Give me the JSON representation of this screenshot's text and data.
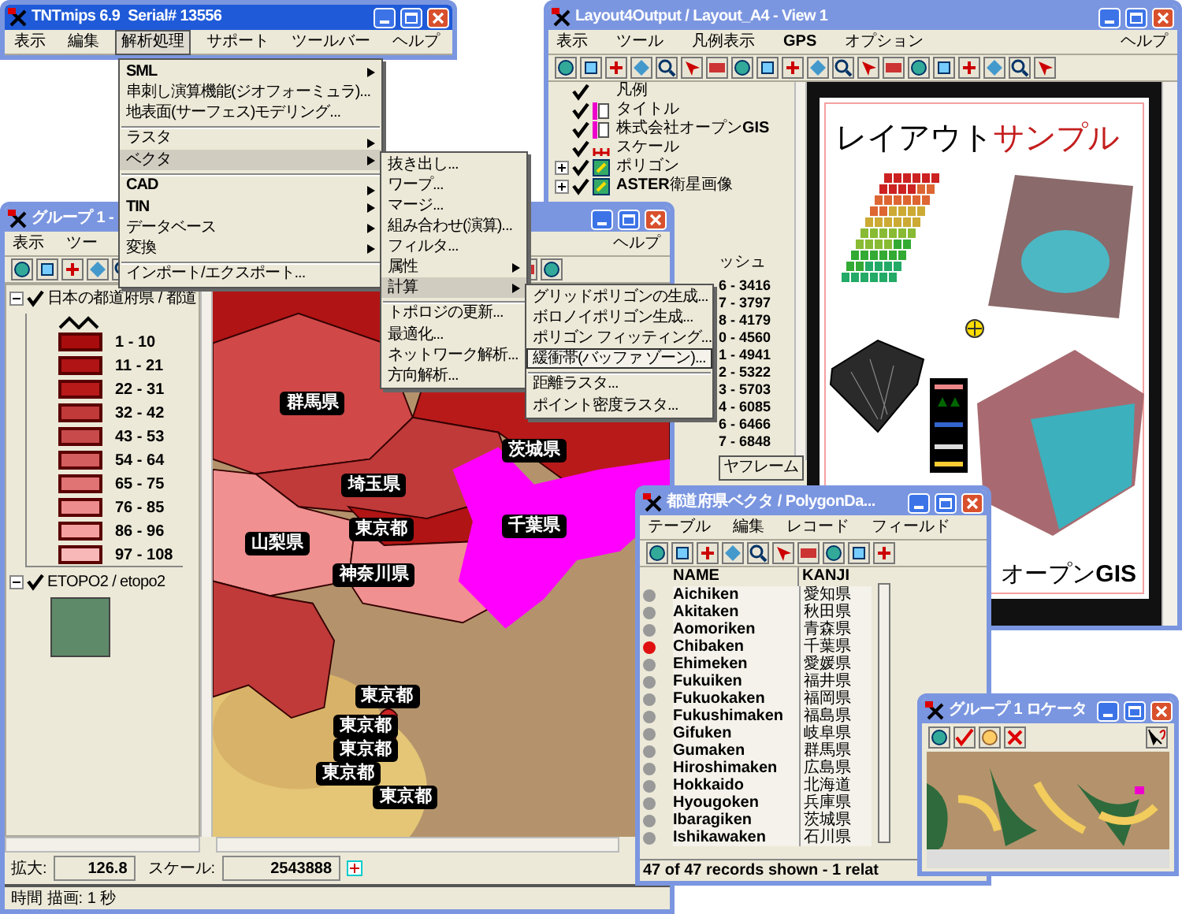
{
  "layout_window": {
    "title": "Layout4Output / Layout_A4 - View 1",
    "active": false,
    "menu": [
      {
        "label": "表示",
        "bold": false
      },
      {
        "label": "ツール",
        "bold": false
      },
      {
        "label": "凡例表示",
        "bold": false
      },
      {
        "label": "GPS",
        "bold": true
      },
      {
        "label": "オプション",
        "bold": false
      }
    ],
    "menu_right": "ヘルプ",
    "legend": [
      {
        "label": "凡例",
        "checked": true,
        "expandable": false,
        "kind": "plain"
      },
      {
        "label": "タイトル",
        "checked": true,
        "expandable": false,
        "kind": "text"
      },
      {
        "label": "株式会社オープン**GIS**",
        "checked": true,
        "expandable": false,
        "kind": "text"
      },
      {
        "label": "スケール",
        "checked": true,
        "expandable": false,
        "kind": "scale"
      },
      {
        "label": "ポリゴン",
        "checked": true,
        "expandable": true,
        "kind": "layer"
      },
      {
        "label": "**ASTER**衛星画像",
        "checked": true,
        "expandable": true,
        "kind": "layer"
      }
    ],
    "partial_legend": {
      "heading": "ッシュ",
      "ranges": [
        "6 - 3416",
        "7 - 3797",
        "8 - 4179",
        "0 - 4560",
        "1 - 4941",
        "2 - 5322",
        "3 - 5703",
        "4 - 6085",
        "6 - 6466",
        "7 - 6848"
      ]
    },
    "frame_button": "ヤフレーム",
    "page": {
      "title_main": "レイアウト",
      "title_accent": "サンプル",
      "footer": "オープン**GIS**"
    }
  },
  "group_window": {
    "title": "グループ 1 -",
    "active": false,
    "menu": [
      "表示",
      "ツー"
    ],
    "menu_right": "ヘルプ",
    "layers": [
      {
        "label": "日本の都道府県 / 都道",
        "checked": true,
        "expanded": true,
        "classes": [
          {
            "label": "1 - 10",
            "color": "#a80c0c"
          },
          {
            "label": "11 - 21",
            "color": "#b01414"
          },
          {
            "label": "22 - 31",
            "color": "#b81a1a"
          },
          {
            "label": "32 - 42",
            "color": "#c03a3a"
          },
          {
            "label": "43 - 53",
            "color": "#c84a4a"
          },
          {
            "label": "54 - 64",
            "color": "#d45e5e"
          },
          {
            "label": "65 - 75",
            "color": "#e07474"
          },
          {
            "label": "76 - 85",
            "color": "#ec8c8c"
          },
          {
            "label": "86 - 96",
            "color": "#f4a0a0"
          },
          {
            "label": "97 - 108",
            "color": "#f8b8b8"
          }
        ]
      },
      {
        "label": "ETOPO2 / etopo2",
        "checked": true,
        "expanded": true
      }
    ],
    "map_labels": [
      "群馬県",
      "茨城県",
      "埼玉県",
      "東京都",
      "千葉県",
      "山梨県",
      "神奈川県",
      "東京都",
      "東京都",
      "東京都",
      "東京都",
      "東京都"
    ],
    "zoom_label": "拡大:",
    "zoom_value": "126.8",
    "scale_label": "スケール:",
    "scale_value": "2543888",
    "status": "時間 描画: 1 秒"
  },
  "table_window": {
    "title": "都道府県ベクタ / PolygonDa...",
    "active": false,
    "menu": [
      "テーブル",
      "編集",
      "レコード",
      "フィールド"
    ],
    "columns": [
      "NAME",
      "KANJI"
    ],
    "rows": [
      {
        "name": "Aichiken",
        "kanji": "愛知県",
        "selected": false
      },
      {
        "name": "Akitaken",
        "kanji": "秋田県",
        "selected": false
      },
      {
        "name": "Aomoriken",
        "kanji": "青森県",
        "selected": false
      },
      {
        "name": "Chibaken",
        "kanji": "千葉県",
        "selected": true
      },
      {
        "name": "Ehimeken",
        "kanji": "愛媛県",
        "selected": false
      },
      {
        "name": "Fukuiken",
        "kanji": "福井県",
        "selected": false
      },
      {
        "name": "Fukuokaken",
        "kanji": "福岡県",
        "selected": false
      },
      {
        "name": "Fukushimaken",
        "kanji": "福島県",
        "selected": false
      },
      {
        "name": "Gifuken",
        "kanji": "岐阜県",
        "selected": false
      },
      {
        "name": "Gumaken",
        "kanji": "群馬県",
        "selected": false
      },
      {
        "name": "Hiroshimaken",
        "kanji": "広島県",
        "selected": false
      },
      {
        "name": "Hokkaido",
        "kanji": "北海道",
        "selected": false
      },
      {
        "name": "Hyougoken",
        "kanji": "兵庫県",
        "selected": false
      },
      {
        "name": "Ibaragiken",
        "kanji": "茨城県",
        "selected": false
      },
      {
        "name": "Ishikawaken",
        "kanji": "石川県",
        "selected": false
      }
    ],
    "status": "47 of 47 records shown - 1 relat"
  },
  "locator_window": {
    "title": "グループ 1 ロケータ",
    "active": false
  },
  "main_window": {
    "title": "TNTmips 6.9  Serial# 13556",
    "active": true,
    "menu": [
      {
        "label": "表示",
        "selected": false
      },
      {
        "label": "編集",
        "selected": false
      },
      {
        "label": "解析処理",
        "selected": true
      },
      {
        "label": "サポート",
        "selected": false
      },
      {
        "label": "ツールバー",
        "selected": false
      },
      {
        "label": "ヘルプ",
        "selected": false
      }
    ],
    "dropdown": [
      {
        "label": "SML",
        "bold": true,
        "submenu": true,
        "selected": false,
        "divider": false
      },
      {
        "label": "串刺し演算機能(ジオフォーミュラ)...",
        "bold": false,
        "submenu": false,
        "selected": false,
        "divider": false
      },
      {
        "label": "地表面(サーフェス)モデリング...",
        "bold": false,
        "submenu": false,
        "selected": false,
        "divider": false
      },
      {
        "label": "ラスタ",
        "bold": false,
        "submenu": true,
        "selected": false,
        "divider": true
      },
      {
        "label": "ベクタ",
        "bold": false,
        "submenu": true,
        "selected": true,
        "divider": false
      },
      {
        "label": "CAD",
        "bold": true,
        "submenu": true,
        "selected": false,
        "divider": true
      },
      {
        "label": "TIN",
        "bold": true,
        "submenu": true,
        "selected": false,
        "divider": false
      },
      {
        "label": "データベース",
        "bold": false,
        "submenu": true,
        "selected": false,
        "divider": false
      },
      {
        "label": "変換",
        "bold": false,
        "submenu": true,
        "selected": false,
        "divider": false
      },
      {
        "label": "インポート/エクスポート...",
        "bold": false,
        "submenu": false,
        "selected": false,
        "divider": true
      }
    ],
    "submenu": [
      {
        "label": "抜き出し...",
        "submenu": false,
        "selected": false,
        "divider": false
      },
      {
        "label": "ワープ...",
        "submenu": false,
        "selected": false,
        "divider": false
      },
      {
        "label": "マージ...",
        "submenu": false,
        "selected": false,
        "divider": false
      },
      {
        "label": "組み合わせ(演算)...",
        "submenu": false,
        "selected": false,
        "divider": false
      },
      {
        "label": "フィルタ...",
        "submenu": false,
        "selected": false,
        "divider": false
      },
      {
        "label": "属性",
        "submenu": true,
        "selected": false,
        "divider": false
      },
      {
        "label": "計算",
        "submenu": true,
        "selected": true,
        "divider": false
      },
      {
        "label": "トポロジの更新...",
        "submenu": false,
        "selected": false,
        "divider": true
      },
      {
        "label": "最適化...",
        "submenu": false,
        "selected": false,
        "divider": false
      },
      {
        "label": "ネットワーク解析...",
        "submenu": false,
        "selected": false,
        "divider": false
      },
      {
        "label": "方向解析...",
        "submenu": false,
        "selected": false,
        "divider": false
      }
    ],
    "submenu2": [
      {
        "label": "グリッドポリゴンの生成...",
        "selected": false,
        "divider": false
      },
      {
        "label": "ボロノイポリゴン生成...",
        "selected": false,
        "divider": false
      },
      {
        "label": "ポリゴン フィッティング...",
        "selected": false,
        "divider": false
      },
      {
        "label": "緩衝帯(バッファ ゾーン)...",
        "selected": true,
        "divider": false
      },
      {
        "label": "距離ラスタ...",
        "selected": false,
        "divider": true
      },
      {
        "label": "ポイント密度ラスタ...",
        "selected": false,
        "divider": false
      }
    ]
  }
}
